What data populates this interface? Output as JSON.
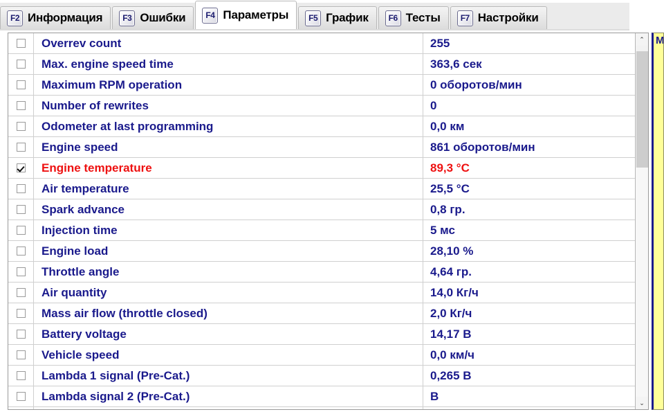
{
  "window": {
    "title": "Параметры"
  },
  "tabs": [
    {
      "fkey": "F2",
      "label": "Информация",
      "active": false
    },
    {
      "fkey": "F3",
      "label": "Ошибки",
      "active": false
    },
    {
      "fkey": "F4",
      "label": "Параметры",
      "active": true
    },
    {
      "fkey": "F5",
      "label": "График",
      "active": false
    },
    {
      "fkey": "F6",
      "label": "Тесты",
      "active": false
    },
    {
      "fkey": "F7",
      "label": "Настройки",
      "active": false
    }
  ],
  "parameters_table": {
    "rows": [
      {
        "checked": false,
        "name": "Overrev count",
        "value": "255",
        "alert": false
      },
      {
        "checked": false,
        "name": "Max. engine speed time",
        "value": "363,6 сек",
        "alert": false
      },
      {
        "checked": false,
        "name": "Maximum RPM operation",
        "value": "0 оборотов/мин",
        "alert": false
      },
      {
        "checked": false,
        "name": "Number of rewrites",
        "value": "0",
        "alert": false
      },
      {
        "checked": false,
        "name": "Odometer at last programming",
        "value": "0,0 км",
        "alert": false
      },
      {
        "checked": false,
        "name": "Engine speed",
        "value": "861 оборотов/мин",
        "alert": false
      },
      {
        "checked": true,
        "name": "Engine temperature",
        "value": "89,3 °C",
        "alert": true
      },
      {
        "checked": false,
        "name": "Air temperature",
        "value": "25,5 °C",
        "alert": false
      },
      {
        "checked": false,
        "name": "Spark advance",
        "value": "0,8 гр.",
        "alert": false
      },
      {
        "checked": false,
        "name": "Injection time",
        "value": "5 мс",
        "alert": false
      },
      {
        "checked": false,
        "name": "Engine load",
        "value": "28,10 %",
        "alert": false
      },
      {
        "checked": false,
        "name": "Throttle angle",
        "value": "4,64 гр.",
        "alert": false
      },
      {
        "checked": false,
        "name": "Air quantity",
        "value": "14,0 Кг/ч",
        "alert": false
      },
      {
        "checked": false,
        "name": "Mass air flow (throttle closed)",
        "value": "2,0 Кг/ч",
        "alert": false
      },
      {
        "checked": false,
        "name": "Battery voltage",
        "value": "14,17 В",
        "alert": false
      },
      {
        "checked": false,
        "name": "Vehicle speed",
        "value": "0,0 км/ч",
        "alert": false
      },
      {
        "checked": false,
        "name": "Lambda 1 signal (Pre-Cat.)",
        "value": "0,265 В",
        "alert": false
      },
      {
        "checked": false,
        "name": "Lambda signal 2 (Pre-Cat.)",
        "value": "В",
        "alert": false
      }
    ]
  },
  "scrollbar": {
    "up_arrow": "⌃",
    "down_arrow": "⌄"
  },
  "right_panel": {
    "clipped_text": "М"
  },
  "colors": {
    "label_blue": "#1a1a8c",
    "alert_red": "#ee1111",
    "panel_yellow": "#ffff99",
    "grid_line": "#cfcfcf"
  }
}
